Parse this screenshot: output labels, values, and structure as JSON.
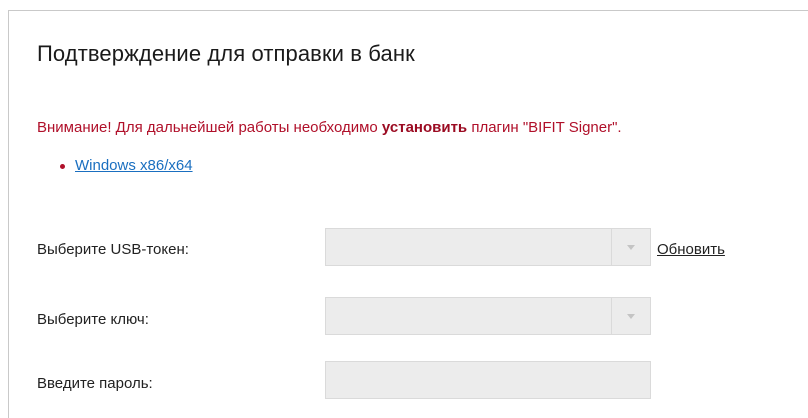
{
  "dialog": {
    "title": "Подтверждение для отправки в банк",
    "warning": {
      "prefix": "Внимание! Для дальнейшей работы необходимо ",
      "emphasis": "установить",
      "suffix": " плагин \"BIFIT Signer\"."
    },
    "download_links": [
      {
        "label": "Windows x86/x64"
      }
    ],
    "form": {
      "usb_token_label": "Выберите USB-токен:",
      "usb_token_value": "",
      "refresh_label": "Обновить",
      "key_label": "Выберите ключ:",
      "key_value": "",
      "password_label": "Введите пароль:",
      "password_value": ""
    }
  },
  "colors": {
    "warning_text": "#b0102a",
    "link": "#1a6fc0",
    "field_background": "#ececec"
  }
}
